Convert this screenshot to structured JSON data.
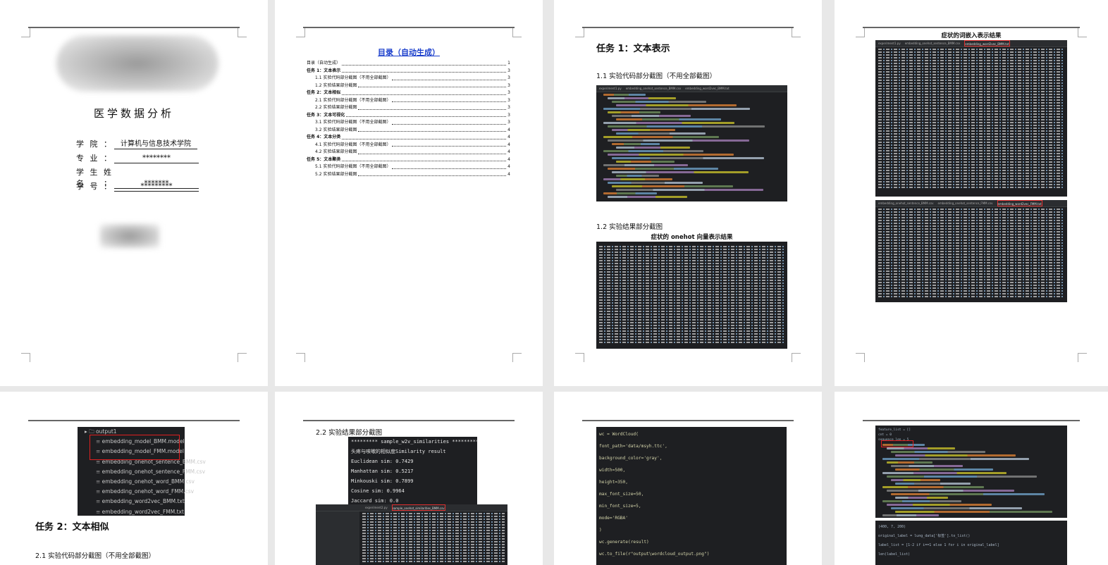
{
  "cover": {
    "title": "医学数据分析",
    "fields": [
      {
        "label": "学院：",
        "value": "计算机与信息技术学院"
      },
      {
        "label": "专业：",
        "value": "********"
      },
      {
        "label": "学生姓名：",
        "value": "*******"
      },
      {
        "label": "学号：",
        "value": "*********"
      }
    ]
  },
  "toc": {
    "title": "目录（自动生成）",
    "entries": [
      {
        "text": "目录（自动生成）",
        "page": "1",
        "level": 1
      },
      {
        "text": "任务 1：文本表示",
        "page": "3",
        "level": 1
      },
      {
        "text": "1.1 实验代码部分截图（不用全部截图）",
        "page": "3",
        "level": 2
      },
      {
        "text": "1.2 实验结果部分截图",
        "page": "3",
        "level": 2
      },
      {
        "text": "任务 2：文本相似",
        "page": "3",
        "level": 1
      },
      {
        "text": "2.1 实验代码部分截图（不用全部截图）",
        "page": "3",
        "level": 2
      },
      {
        "text": "2.2 实验结果部分截图",
        "page": "3",
        "level": 2
      },
      {
        "text": "任务 3：文本可视化",
        "page": "3",
        "level": 1
      },
      {
        "text": "3.1 实验代码部分截图（不用全部截图）",
        "page": "3",
        "level": 2
      },
      {
        "text": "3.2 实验结果部分截图",
        "page": "4",
        "level": 2
      },
      {
        "text": "任务 4：文本分类",
        "page": "4",
        "level": 1
      },
      {
        "text": "4.1 实验代码部分截图（不用全部截图）",
        "page": "4",
        "level": 2
      },
      {
        "text": "4.2 实验结果部分截图",
        "page": "4",
        "level": 2
      },
      {
        "text": "任务 5：文本聚类",
        "page": "4",
        "level": 1
      },
      {
        "text": "5.1 实验代码部分截图（不用全部截图）",
        "page": "4",
        "level": 2
      },
      {
        "text": "5.2 实验结果部分截图",
        "page": "4",
        "level": 2
      }
    ]
  },
  "page3": {
    "heading": "任务 1：文本表示",
    "sub1": "1.1 实验代码部分截图（不用全部截图）",
    "sub2": "1.2 实验结果部分截图",
    "code_tabs": [
      "experiment1.py",
      "embedding_onehot_sentence_BMM.csv",
      "embedding_word2vec_BMM.txt"
    ],
    "result_caption": "症状的 onehot 向量表示结果"
  },
  "page4": {
    "caption": "症状的词嵌入表示结果",
    "tabs_top": [
      "experiment1.py",
      "embedding_onehot_sentence_BMM.csv",
      "embedding_word2vec_BMM.txt"
    ],
    "tabs_bottom": [
      "embedding_onehot_sentence_BMM.csv",
      "embedding_onehot_sentence_FMM.csv",
      "embedding_word2vec_FMM.txt"
    ]
  },
  "page5": {
    "folder": "output1",
    "files": [
      "embedding_model_BMM.model",
      "embedding_model_FMM.model",
      "embedding_onehot_sentence_BMM.csv",
      "embedding_onehot_sentence_FMM.csv",
      "embedding_onehot_word_BMM.csv",
      "embedding_onehot_word_FMM.csv",
      "embedding_word2vec_BMM.txt",
      "embedding_word2vec_FMM.txt"
    ],
    "heading": "任务 2：文本相似",
    "sub": "2.1 实验代码部分截图（不用全部截图）"
  },
  "page6": {
    "sub": "2.2 实验结果部分截图",
    "terminal_lines": [
      "********* sample_w2v_similarities *********",
      "头疼与咳嗽的相似度Similarity result",
      "Euclidean sim: 0.7429",
      "Manhattan sim: 0.5217",
      "Minkouski sim: 0.7899",
      "Cosine sim: 0.9964",
      "Jaccard sim: 0.0"
    ],
    "tabs": [
      "experiment2.py",
      "sample_onehot_similarities_BMM.csv"
    ]
  },
  "page7": {
    "code_lines": [
      "wc = WordCloud(",
      "    font_path='data/msyh.ttc',",
      "    background_color='gray',",
      "    width=500,",
      "    height=350,",
      "    max_font_size=50,",
      "    min_font_size=5,",
      "    mode='RGBA'",
      ")",
      "wc.generate(result)",
      "wc.to_file(r\"output\\wordcloud_output.png\")"
    ]
  },
  "page8": {
    "top_code": [
      "feature_list = []",
      "cnt = 0",
      "sequence_len = 5"
    ],
    "bottom_code": [
      "(400, 7, 200)",
      "original_label = lung_data['标签'].to_list()",
      "label_list = [1-2 if i==1 else 1 for i in original_label]",
      "len(label_list)"
    ]
  },
  "colors": {
    "page_bg": "#ffffff",
    "gap_bg": "#e8e8e8",
    "toc_title": "#1a3ecc",
    "code_bg": "#1e1f22",
    "highlight_box": "#e02020"
  }
}
